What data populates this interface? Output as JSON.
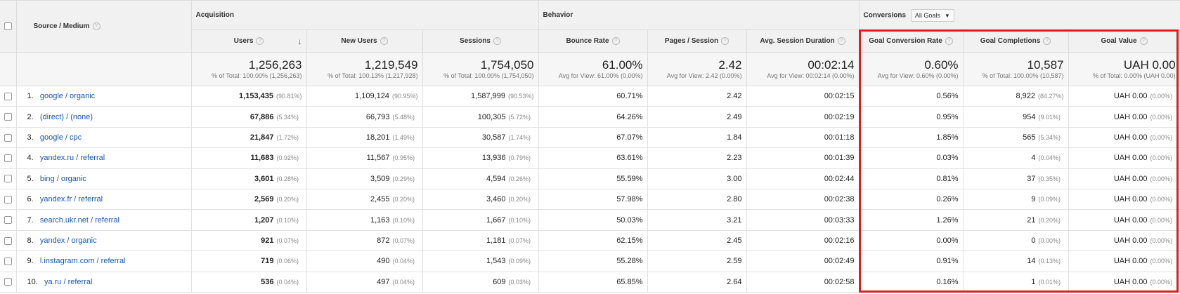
{
  "groups": {
    "acquisition": "Acquisition",
    "behavior": "Behavior",
    "conversions": "Conversions",
    "goals_select": "All Goals"
  },
  "columns": {
    "source_medium": "Source / Medium",
    "users": "Users",
    "new_users": "New Users",
    "sessions": "Sessions",
    "bounce_rate": "Bounce Rate",
    "pages_session": "Pages / Session",
    "avg_duration": "Avg. Session Duration",
    "goal_conv_rate": "Goal Conversion Rate",
    "goal_completions": "Goal Completions",
    "goal_value": "Goal Value"
  },
  "totals": {
    "users": "1,256,263",
    "users_sub": "% of Total: 100.00% (1,256,263)",
    "new_users": "1,219,549",
    "new_users_sub": "% of Total: 100.13% (1,217,928)",
    "sessions": "1,754,050",
    "sessions_sub": "% of Total: 100.00% (1,754,050)",
    "bounce_rate": "61.00%",
    "bounce_rate_sub": "Avg for View: 61.00% (0.00%)",
    "pages_session": "2.42",
    "pages_session_sub": "Avg for View: 2.42 (0.00%)",
    "avg_duration": "00:02:14",
    "avg_duration_sub": "Avg for View: 00:02:14 (0.00%)",
    "goal_conv_rate": "0.60%",
    "goal_conv_rate_sub": "Avg for View: 0.60% (0.00%)",
    "goal_completions": "10,587",
    "goal_completions_sub": "% of Total: 100.00% (10,587)",
    "goal_value": "UAH 0.00",
    "goal_value_sub": "% of Total: 0.00% (UAH 0.00)"
  },
  "rows": [
    {
      "idx": "1.",
      "source": "google / organic",
      "users": "1,153,435",
      "users_pct": "(90.81%)",
      "new_users": "1,109,124",
      "new_users_pct": "(90.95%)",
      "sessions": "1,587,999",
      "sessions_pct": "(90.53%)",
      "bounce": "60.71%",
      "pages": "2.42",
      "duration": "00:02:15",
      "conv_rate": "0.56%",
      "completions": "8,922",
      "completions_pct": "(84.27%)",
      "value": "UAH 0.00",
      "value_pct": "(0.00%)"
    },
    {
      "idx": "2.",
      "source": "(direct) / (none)",
      "users": "67,886",
      "users_pct": "(5.34%)",
      "new_users": "66,793",
      "new_users_pct": "(5.48%)",
      "sessions": "100,305",
      "sessions_pct": "(5.72%)",
      "bounce": "64.26%",
      "pages": "2.49",
      "duration": "00:02:19",
      "conv_rate": "0.95%",
      "completions": "954",
      "completions_pct": "(9.01%)",
      "value": "UAH 0.00",
      "value_pct": "(0.00%)"
    },
    {
      "idx": "3.",
      "source": "google / cpc",
      "users": "21,847",
      "users_pct": "(1.72%)",
      "new_users": "18,201",
      "new_users_pct": "(1.49%)",
      "sessions": "30,587",
      "sessions_pct": "(1.74%)",
      "bounce": "67.07%",
      "pages": "1.84",
      "duration": "00:01:18",
      "conv_rate": "1.85%",
      "completions": "565",
      "completions_pct": "(5.34%)",
      "value": "UAH 0.00",
      "value_pct": "(0.00%)"
    },
    {
      "idx": "4.",
      "source": "yandex.ru / referral",
      "users": "11,683",
      "users_pct": "(0.92%)",
      "new_users": "11,567",
      "new_users_pct": "(0.95%)",
      "sessions": "13,936",
      "sessions_pct": "(0.79%)",
      "bounce": "63.61%",
      "pages": "2.23",
      "duration": "00:01:39",
      "conv_rate": "0.03%",
      "completions": "4",
      "completions_pct": "(0.04%)",
      "value": "UAH 0.00",
      "value_pct": "(0.00%)"
    },
    {
      "idx": "5.",
      "source": "bing / organic",
      "users": "3,601",
      "users_pct": "(0.28%)",
      "new_users": "3,509",
      "new_users_pct": "(0.29%)",
      "sessions": "4,594",
      "sessions_pct": "(0.26%)",
      "bounce": "55.59%",
      "pages": "3.00",
      "duration": "00:02:44",
      "conv_rate": "0.81%",
      "completions": "37",
      "completions_pct": "(0.35%)",
      "value": "UAH 0.00",
      "value_pct": "(0.00%)"
    },
    {
      "idx": "6.",
      "source": "yandex.fr / referral",
      "users": "2,569",
      "users_pct": "(0.20%)",
      "new_users": "2,455",
      "new_users_pct": "(0.20%)",
      "sessions": "3,460",
      "sessions_pct": "(0.20%)",
      "bounce": "57.98%",
      "pages": "2.80",
      "duration": "00:02:38",
      "conv_rate": "0.26%",
      "completions": "9",
      "completions_pct": "(0.09%)",
      "value": "UAH 0.00",
      "value_pct": "(0.00%)"
    },
    {
      "idx": "7.",
      "source": "search.ukr.net / referral",
      "users": "1,207",
      "users_pct": "(0.10%)",
      "new_users": "1,163",
      "new_users_pct": "(0.10%)",
      "sessions": "1,667",
      "sessions_pct": "(0.10%)",
      "bounce": "50.03%",
      "pages": "3.21",
      "duration": "00:03:33",
      "conv_rate": "1.26%",
      "completions": "21",
      "completions_pct": "(0.20%)",
      "value": "UAH 0.00",
      "value_pct": "(0.00%)"
    },
    {
      "idx": "8.",
      "source": "yandex / organic",
      "users": "921",
      "users_pct": "(0.07%)",
      "new_users": "872",
      "new_users_pct": "(0.07%)",
      "sessions": "1,181",
      "sessions_pct": "(0.07%)",
      "bounce": "62.15%",
      "pages": "2.45",
      "duration": "00:02:16",
      "conv_rate": "0.00%",
      "completions": "0",
      "completions_pct": "(0.00%)",
      "value": "UAH 0.00",
      "value_pct": "(0.00%)"
    },
    {
      "idx": "9.",
      "source": "l.instagram.com / referral",
      "users": "719",
      "users_pct": "(0.06%)",
      "new_users": "490",
      "new_users_pct": "(0.04%)",
      "sessions": "1,543",
      "sessions_pct": "(0.09%)",
      "bounce": "55.28%",
      "pages": "2.59",
      "duration": "00:02:49",
      "conv_rate": "0.91%",
      "completions": "14",
      "completions_pct": "(0.13%)",
      "value": "UAH 0.00",
      "value_pct": "(0.00%)"
    },
    {
      "idx": "10.",
      "source": "ya.ru / referral",
      "users": "536",
      "users_pct": "(0.04%)",
      "new_users": "497",
      "new_users_pct": "(0.04%)",
      "sessions": "609",
      "sessions_pct": "(0.03%)",
      "bounce": "65.85%",
      "pages": "2.64",
      "duration": "00:02:58",
      "conv_rate": "0.16%",
      "completions": "1",
      "completions_pct": "(0.01%)",
      "value": "UAH 0.00",
      "value_pct": "(0.00%)"
    }
  ],
  "colors": {
    "highlight": "#e01c1c",
    "link": "#1a57a8",
    "header_bg": "#f1f1f1"
  }
}
